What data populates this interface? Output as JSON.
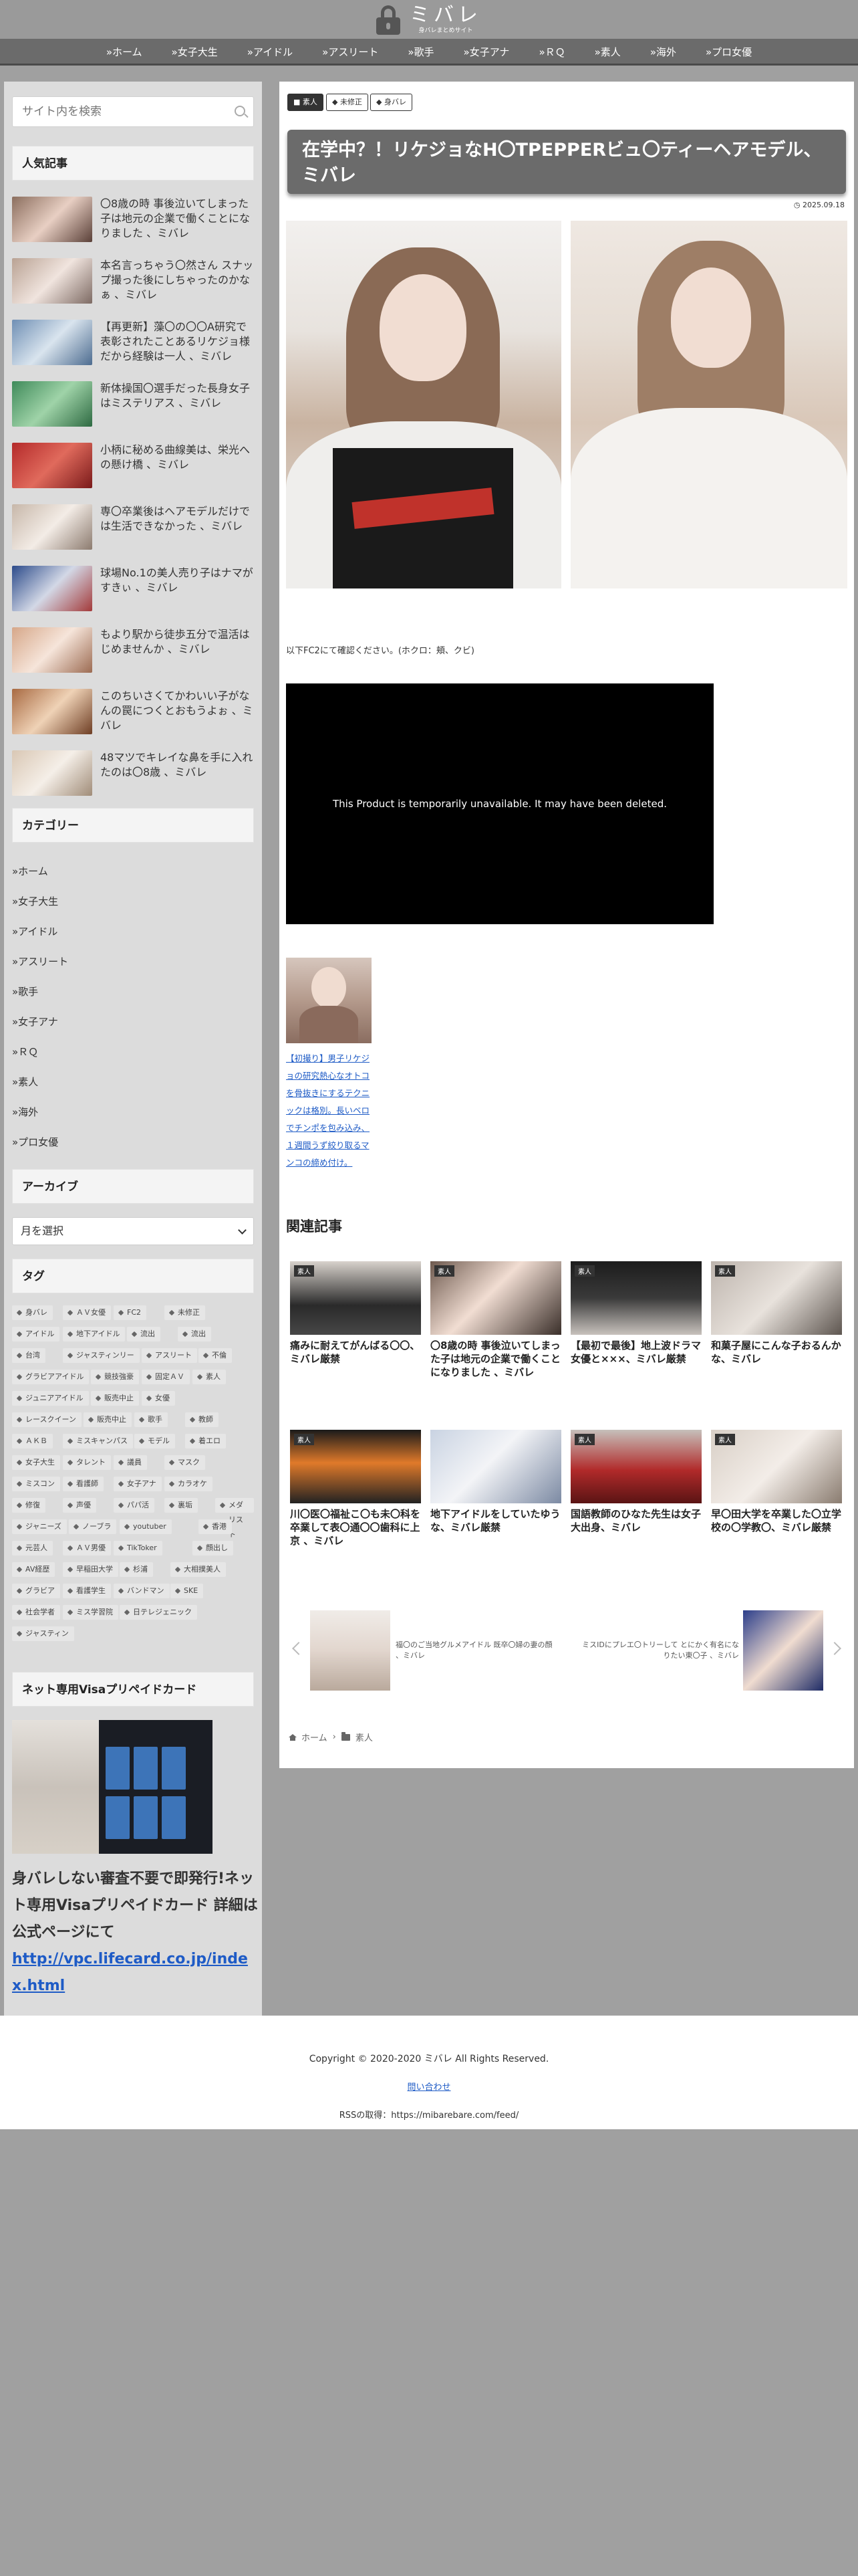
{
  "header": {
    "logo_text": "ミバレ",
    "logo_sub": "身バレまとめサイト"
  },
  "nav": {
    "items": [
      "»ホーム",
      "»女子大生",
      "»アイドル",
      "»アスリート",
      "»歌手",
      "»女子アナ",
      "»ＲＱ",
      "»素人",
      "»海外",
      "»プロ女優"
    ]
  },
  "sidebar": {
    "search_placeholder": "サイト内を検索",
    "popular_title": "人気記事",
    "popular": [
      "〇8歳の時 事後泣いてしまった子は地元の企業で働くことになりました 、ミバレ",
      "本名言っちゃう〇然さん スナップ撮った後にしちゃったのかなぁ 、ミバレ",
      "【再更新】藻〇の〇〇A研究で表彰されたことあるリケジョ様だから経験は一人 、ミバレ",
      "新体操国〇選手だった長身女子はミステリアス 、ミバレ",
      "小柄に秘める曲線美は、栄光への懸け橋 、ミバレ",
      "専〇卒業後はヘアモデルだけでは生活できなかった 、ミバレ",
      "球場No.1の美人売り子はナマがすきぃ 、ミバレ",
      "もより駅から徒歩五分で温活はじめませんか 、ミバレ",
      "このちいさくてかわいい子がなんの罠につくとおもうよぉ 、ミバレ",
      "48マツでキレイな鼻を手に入れたのは〇8歳 、ミバレ"
    ],
    "category_title": "カテゴリー",
    "categories": [
      "»ホーム",
      "»女子大生",
      "»アイドル",
      "»アスリート",
      "»歌手",
      "»女子アナ",
      "»ＲＱ",
      "»素人",
      "»海外",
      "»プロ女優"
    ],
    "archive_title": "アーカイブ",
    "archive_select": "月を選択",
    "tag_title": "タグ",
    "tags": [
      [
        "身バレ",
        "ＡＶ女優",
        "FC2",
        "未修正"
      ],
      [
        "アイドル",
        "地下アイドル",
        "流出",
        "流出"
      ],
      [
        "台湾",
        "ジャスティンリー",
        "アスリート",
        "不倫"
      ],
      [
        "グラビアアイドル",
        "競技強豪",
        "固定ＡＶ",
        "素人"
      ],
      [
        "ジュニアアイドル",
        "販売中止",
        "女優"
      ],
      [
        "レースクイーン",
        "販売中止",
        "歌手",
        "教師"
      ],
      [
        "ＡＫＢ",
        "ミスキャンパス",
        "モデル",
        "着エロ"
      ],
      [
        "女子大生",
        "タレント",
        "議員",
        "マスク"
      ],
      [
        "ミスコン",
        "看護師",
        "女子アナ",
        "カラオケ"
      ],
      [
        "修復",
        "声優",
        "パパ活",
        "裏垢",
        "メダリスト"
      ],
      [
        "ジャニーズ",
        "ノーブラ",
        "youtuber",
        "香港"
      ],
      [
        "元芸人",
        "ＡＶ男優",
        "TikToker",
        "顔出し"
      ],
      [
        "AV経歴",
        "早稲田大学",
        "杉浦",
        "大相撲美人"
      ],
      [
        "グラビア",
        "看護学生",
        "バンドマン",
        "SKE"
      ],
      [
        "社会学者",
        "ミス学習院",
        "日テレジェニック"
      ],
      [
        "ジャスティン"
      ]
    ],
    "card_title": "ネット専用Visaプリペイドカード",
    "card_text": "身バレしない審査不要で即発行!ネット専用Visaプリペイドカード 詳細は公式ページにて",
    "card_link": "http://vpc.lifecard.co.jp/index.html"
  },
  "article": {
    "badges": [
      "素人",
      "未修正",
      "身バレ"
    ],
    "title": "在学中？！リケジョなH〇TPEPPERビュ〇ティーヘアモデル、ミバレ",
    "date": "2025.09.18",
    "fc2_note": "以下FC2にて確認ください。(ホクロ：頬、クビ)",
    "video_message": "This Product is temporarily unavailable. It may have been deleted.",
    "promo_text": "【初撮り】男子リケジョの研究熱心なオトコを骨抜きにするテクニックは格別。長いベロでチンポを包み込み、１週間うず絞り取るマンコの締め付け。",
    "related_title": "関連記事",
    "related": [
      {
        "badge": "素人",
        "title": "痛みに耐えてがんばる〇〇、ミバレ厳禁"
      },
      {
        "badge": "素人",
        "title": "〇8歳の時 事後泣いてしまった子は地元の企業で働くことになりました 、ミバレ"
      },
      {
        "badge": "素人",
        "title": "【最初で最後】地上波ドラマ女優と×××、ミバレ厳禁"
      },
      {
        "badge": "素人",
        "title": "和菓子屋にこんな子おるんかな、ミバレ"
      },
      {
        "badge": "素人",
        "title": "川〇医〇福祉こ〇も未〇科を卒業して表〇通〇〇歯科に上京 、ミバレ"
      },
      {
        "badge": "",
        "title": "地下アイドルをしていたゆうな、ミバレ厳禁"
      },
      {
        "badge": "素人",
        "title": "国語教師のひなた先生は女子大出身、ミバレ"
      },
      {
        "badge": "素人",
        "title": "早〇田大学を卒業した〇立学校の〇学教〇、ミバレ厳禁"
      }
    ],
    "carousel_left": "福〇のご当地グルメアイドル 既卒〇婦の妻の顔 、ミバレ",
    "carousel_right": "ミスIDにプレエ〇トリーして とにかく有名になりたい東〇子 、ミバレ",
    "breadcrumb_home": "ホーム",
    "breadcrumb_cat": "素人"
  },
  "footer": {
    "copyright": "Copyright © 2020-2020 ミバレ All Rights Reserved.",
    "contact": "問い合わせ",
    "rss": "RSSの取得：https://mibarebare.com/feed/"
  }
}
